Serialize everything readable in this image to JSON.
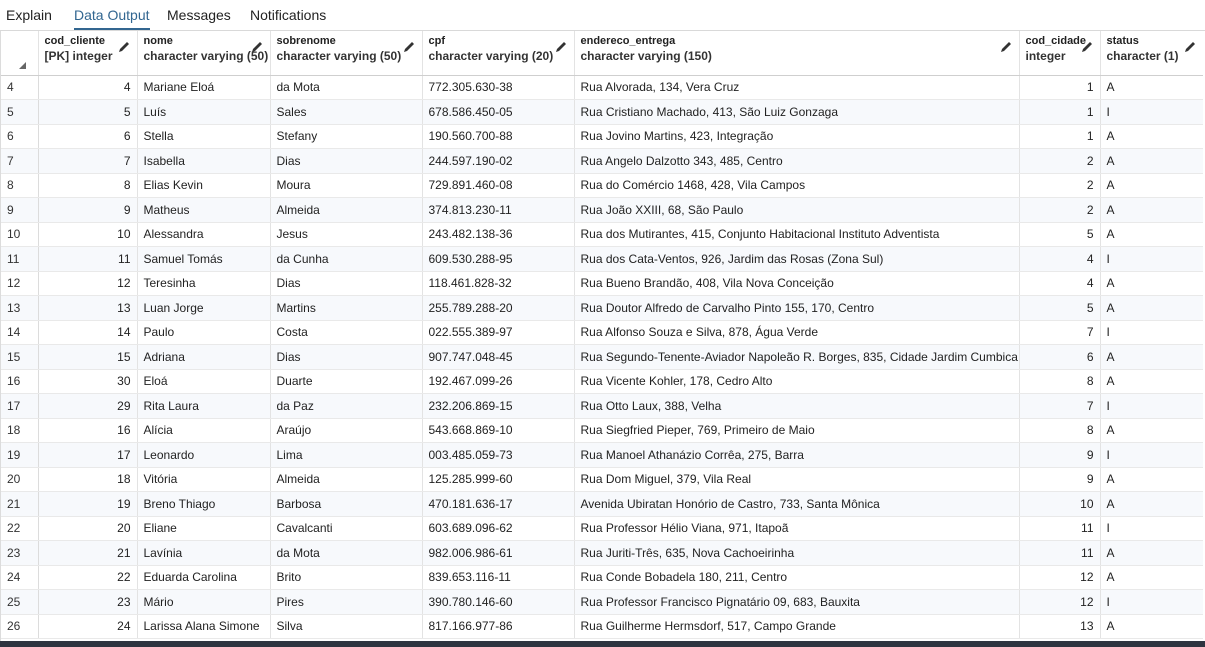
{
  "tabs": [
    {
      "label": "Explain",
      "active": false
    },
    {
      "label": "Data Output",
      "active": true
    },
    {
      "label": "Messages",
      "active": false
    },
    {
      "label": "Notifications",
      "active": false
    }
  ],
  "columns": [
    {
      "name": "cod_cliente",
      "type": "[PK] integer"
    },
    {
      "name": "nome",
      "type": "character varying (50)"
    },
    {
      "name": "sobrenome",
      "type": "character varying (50)"
    },
    {
      "name": "cpf",
      "type": "character varying (20)"
    },
    {
      "name": "endereco_entrega",
      "type": "character varying (150)"
    },
    {
      "name": "cod_cidade",
      "type": "integer"
    },
    {
      "name": "status",
      "type": "character (1)"
    }
  ],
  "rows": [
    {
      "rn": "4",
      "cod": "4",
      "nome": "Mariane Eloá",
      "sobrenome": "da Mota",
      "cpf": "772.305.630-38",
      "end": "Rua Alvorada, 134, Vera Cruz",
      "cidade": "1",
      "status": "A"
    },
    {
      "rn": "5",
      "cod": "5",
      "nome": "Luís",
      "sobrenome": "Sales",
      "cpf": "678.586.450-05",
      "end": "Rua Cristiano Machado, 413, São Luiz Gonzaga",
      "cidade": "1",
      "status": "I"
    },
    {
      "rn": "6",
      "cod": "6",
      "nome": "Stella",
      "sobrenome": "Stefany",
      "cpf": "190.560.700-88",
      "end": "Rua Jovino Martins, 423, Integração",
      "cidade": "1",
      "status": "A"
    },
    {
      "rn": "7",
      "cod": "7",
      "nome": "Isabella",
      "sobrenome": "Dias",
      "cpf": "244.597.190-02",
      "end": "Rua Angelo Dalzotto 343, 485, Centro",
      "cidade": "2",
      "status": "A"
    },
    {
      "rn": "8",
      "cod": "8",
      "nome": "Elias Kevin",
      "sobrenome": "Moura",
      "cpf": "729.891.460-08",
      "end": "Rua do Comércio 1468, 428, Vila Campos",
      "cidade": "2",
      "status": "A"
    },
    {
      "rn": "9",
      "cod": "9",
      "nome": "Matheus",
      "sobrenome": "Almeida",
      "cpf": "374.813.230-11",
      "end": "Rua João XXIII, 68, São Paulo",
      "cidade": "2",
      "status": "A"
    },
    {
      "rn": "10",
      "cod": "10",
      "nome": "Alessandra",
      "sobrenome": "Jesus",
      "cpf": "243.482.138-36",
      "end": "Rua dos Mutirantes, 415, Conjunto Habitacional Instituto Adventista",
      "cidade": "5",
      "status": "A"
    },
    {
      "rn": "11",
      "cod": "11",
      "nome": "Samuel Tomás",
      "sobrenome": "da Cunha",
      "cpf": "609.530.288-95",
      "end": "Rua dos Cata-Ventos, 926, Jardim das Rosas (Zona Sul)",
      "cidade": "4",
      "status": "I"
    },
    {
      "rn": "12",
      "cod": "12",
      "nome": "Teresinha",
      "sobrenome": "Dias",
      "cpf": "118.461.828-32",
      "end": "Rua Bueno Brandão, 408, Vila Nova Conceição",
      "cidade": "4",
      "status": "A"
    },
    {
      "rn": "13",
      "cod": "13",
      "nome": "Luan Jorge",
      "sobrenome": "Martins",
      "cpf": "255.789.288-20",
      "end": "Rua Doutor Alfredo de Carvalho Pinto 155, 170, Centro",
      "cidade": "5",
      "status": "A"
    },
    {
      "rn": "14",
      "cod": "14",
      "nome": "Paulo",
      "sobrenome": "Costa",
      "cpf": "022.555.389-97",
      "end": "Rua Alfonso Souza e Silva, 878, Água Verde",
      "cidade": "7",
      "status": "I"
    },
    {
      "rn": "15",
      "cod": "15",
      "nome": "Adriana",
      "sobrenome": "Dias",
      "cpf": "907.747.048-45",
      "end": "Rua Segundo-Tenente-Aviador Napoleão R. Borges, 835, Cidade Jardim Cumbica",
      "cidade": "6",
      "status": "A"
    },
    {
      "rn": "16",
      "cod": "30",
      "nome": "Eloá",
      "sobrenome": "Duarte",
      "cpf": "192.467.099-26",
      "end": "Rua Vicente Kohler, 178, Cedro Alto",
      "cidade": "8",
      "status": "A"
    },
    {
      "rn": "17",
      "cod": "29",
      "nome": "Rita Laura",
      "sobrenome": "da Paz",
      "cpf": "232.206.869-15",
      "end": "Rua Otto Laux, 388, Velha",
      "cidade": "7",
      "status": "I"
    },
    {
      "rn": "18",
      "cod": "16",
      "nome": "Alícia",
      "sobrenome": "Araújo",
      "cpf": "543.668.869-10",
      "end": "Rua Siegfried Pieper, 769, Primeiro de Maio",
      "cidade": "8",
      "status": "A"
    },
    {
      "rn": "19",
      "cod": "17",
      "nome": "Leonardo",
      "sobrenome": "Lima",
      "cpf": "003.485.059-73",
      "end": "Rua Manoel Athanázio Corrêa, 275, Barra",
      "cidade": "9",
      "status": "I"
    },
    {
      "rn": "20",
      "cod": "18",
      "nome": "Vitória",
      "sobrenome": "Almeida",
      "cpf": "125.285.999-60",
      "end": "Rua Dom Miguel, 379, Vila Real",
      "cidade": "9",
      "status": "A"
    },
    {
      "rn": "21",
      "cod": "19",
      "nome": "Breno Thiago",
      "sobrenome": "Barbosa",
      "cpf": "470.181.636-17",
      "end": "Avenida Ubiratan Honório de Castro, 733, Santa Mônica",
      "cidade": "10",
      "status": "A"
    },
    {
      "rn": "22",
      "cod": "20",
      "nome": "Eliane",
      "sobrenome": "Cavalcanti",
      "cpf": "603.689.096-62",
      "end": "Rua Professor Hélio Viana, 971, Itapoã",
      "cidade": "11",
      "status": "I"
    },
    {
      "rn": "23",
      "cod": "21",
      "nome": "Lavínia",
      "sobrenome": "da Mota",
      "cpf": "982.006.986-61",
      "end": "Rua Juriti-Três, 635, Nova Cachoeirinha",
      "cidade": "11",
      "status": "A"
    },
    {
      "rn": "24",
      "cod": "22",
      "nome": "Eduarda Carolina",
      "sobrenome": "Brito",
      "cpf": "839.653.116-11",
      "end": "Rua Conde Bobadela 180, 211, Centro",
      "cidade": "12",
      "status": "A"
    },
    {
      "rn": "25",
      "cod": "23",
      "nome": "Mário",
      "sobrenome": "Pires",
      "cpf": "390.780.146-60",
      "end": "Rua Professor Francisco Pignatário 09, 683, Bauxita",
      "cidade": "12",
      "status": "I"
    },
    {
      "rn": "26",
      "cod": "24",
      "nome": "Larissa Alana Simone",
      "sobrenome": "Silva",
      "cpf": "817.166.977-86",
      "end": "Rua Guilherme Hermsdorf, 517, Campo Grande",
      "cidade": "13",
      "status": "A"
    }
  ]
}
